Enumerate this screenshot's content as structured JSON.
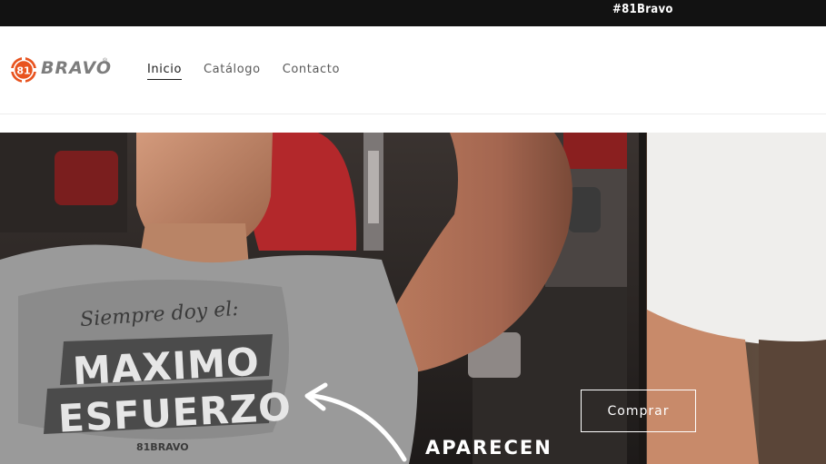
{
  "announcement": {
    "text": "#81Bravo"
  },
  "header": {
    "logo": {
      "badge_text": "81",
      "wordmark": "BRAVO",
      "registered": "®"
    },
    "nav": [
      {
        "label": "Inicio",
        "active": true
      },
      {
        "label": "Catálogo",
        "active": false
      },
      {
        "label": "Contacto",
        "active": false
      }
    ]
  },
  "hero": {
    "shirt_text": {
      "script": "Siempre doy el:",
      "line1": "MAXIMO",
      "line2": "ESFUERZO",
      "brand": "81BRAVO"
    },
    "overlay_text": "APARECEN",
    "cta_label": "Comprar"
  },
  "colors": {
    "brand_orange": "#e8531f",
    "announce_bg": "#121212",
    "logo_gray": "#7d7d7d"
  },
  "icons": {
    "logo_badge": "81-badge-icon",
    "arrow": "curved-arrow-icon"
  }
}
